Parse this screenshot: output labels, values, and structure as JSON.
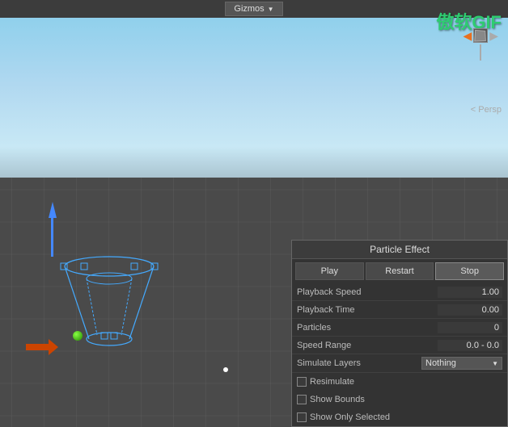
{
  "topbar": {
    "gizmos_label": "Gizmos"
  },
  "watermark": {
    "text": "傲软GIF"
  },
  "viewport": {
    "persp_label": "< Persp"
  },
  "particle_panel": {
    "title": "Particle Effect",
    "play_button": "Play",
    "restart_button": "Restart",
    "stop_button": "Stop",
    "properties": [
      {
        "label": "Playback Speed",
        "value": "1.00"
      },
      {
        "label": "Playback Time",
        "value": "0.00"
      },
      {
        "label": "Particles",
        "value": "0"
      },
      {
        "label": "Speed Range",
        "value": "0.0 - 0.0"
      },
      {
        "label": "Simulate Layers",
        "value": "Nothing"
      }
    ],
    "checkboxes": [
      {
        "label": "Resimulate",
        "checked": false
      },
      {
        "label": "Show Bounds",
        "checked": false
      },
      {
        "label": "Show Only Selected",
        "checked": false
      }
    ]
  }
}
